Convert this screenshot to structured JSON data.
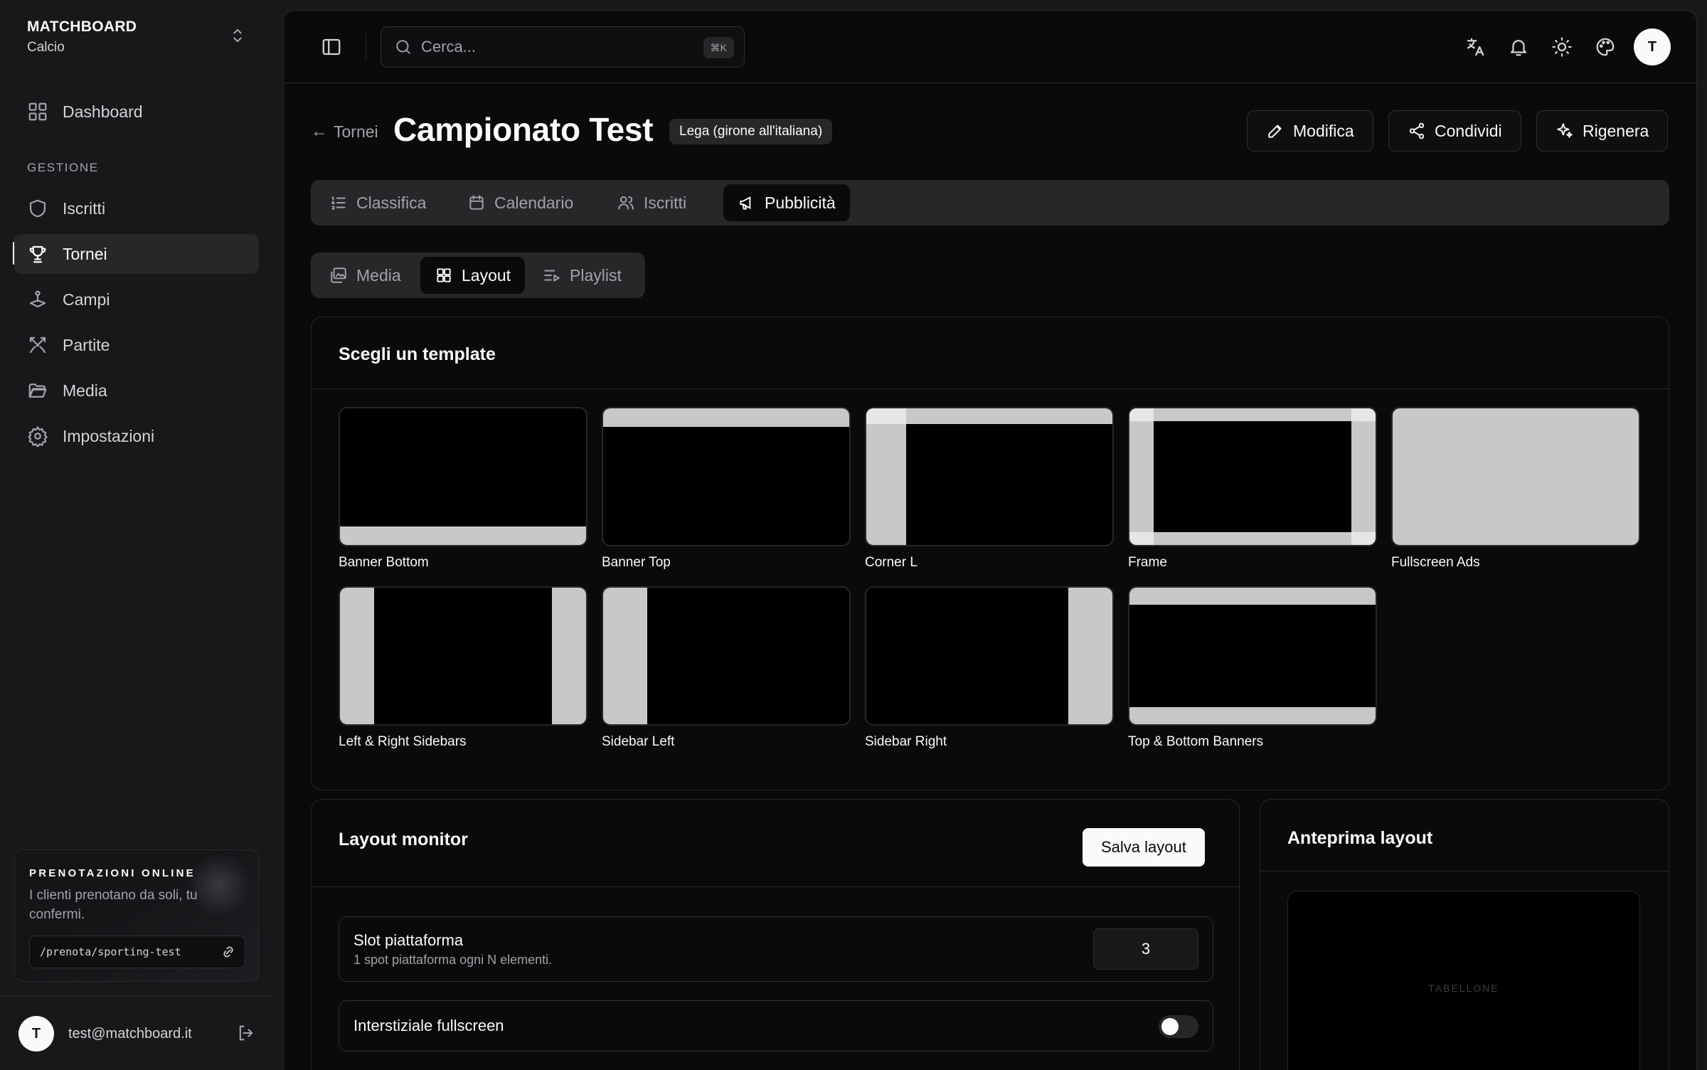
{
  "brand": {
    "title": "MATCHBOARD",
    "subtitle": "Calcio"
  },
  "sidebar": {
    "dashboard": "Dashboard",
    "section": "GESTIONE",
    "items": [
      "Iscritti",
      "Tornei",
      "Campi",
      "Partite",
      "Media",
      "Impostazioni"
    ],
    "active": "Tornei"
  },
  "promo": {
    "title": "PRENOTAZIONI ONLINE",
    "text": "I clienti prenotano da soli, tu confermi.",
    "link": "/prenota/sporting-test"
  },
  "user": {
    "initial": "T",
    "email": "test@matchboard.it"
  },
  "topbar": {
    "search_placeholder": "Cerca...",
    "shortcut": "⌘K",
    "avatar_initial": "T"
  },
  "header": {
    "back_label": "Tornei",
    "title": "Campionato Test",
    "badge": "Lega (girone all'italiana)",
    "actions": [
      "Modifica",
      "Condividi",
      "Rigenera"
    ]
  },
  "tabs": [
    "Classifica",
    "Calendario",
    "Iscritti",
    "Pubblicità"
  ],
  "active_tab": "Pubblicità",
  "subtabs": [
    "Media",
    "Layout",
    "Playlist"
  ],
  "active_subtab": "Layout",
  "templates": {
    "title": "Scegli un template",
    "items": [
      "Banner Bottom",
      "Banner Top",
      "Corner L",
      "Frame",
      "Fullscreen Ads",
      "Left & Right Sidebars",
      "Sidebar Left",
      "Sidebar Right",
      "Top & Bottom Banners"
    ]
  },
  "layout_monitor": {
    "title": "Layout monitor",
    "save_label": "Salva layout",
    "slot": {
      "title": "Slot piattaforma",
      "subtitle": "1 spot piattaforma ogni N elementi.",
      "value": "3"
    },
    "interstitial": {
      "title": "Interstiziale fullscreen",
      "enabled": false
    }
  },
  "preview": {
    "title": "Anteprima layout",
    "screen_label": "TABELLONE"
  },
  "colors": {
    "background": "#0a0a0b",
    "sidebar": "#18181b",
    "border": "#27272a",
    "ad_fill": "#c8c8c8",
    "foreground": "#fafafa"
  }
}
